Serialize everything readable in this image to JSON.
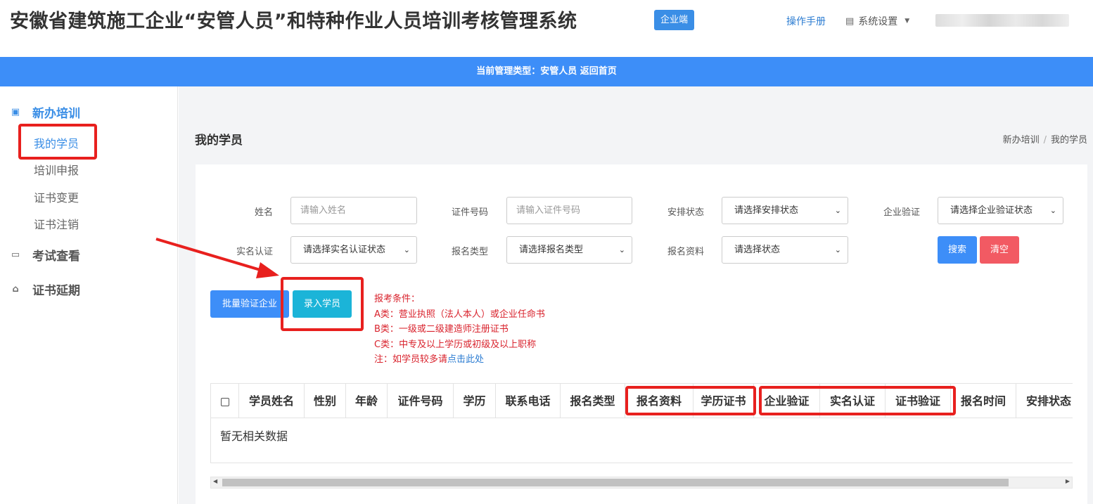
{
  "header": {
    "title": "安徽省建筑施工企业“安管人员”和特种作业人员培训考核管理系统",
    "badge": "企业端",
    "manual": "操作手册",
    "settings": "系统设置"
  },
  "banner": {
    "text": "当前管理类型：安管人员 返回首页"
  },
  "sidebar": {
    "group_new_training": "新办培训",
    "items": [
      "我的学员",
      "培训申报",
      "证书变更",
      "证书注销"
    ],
    "group_exam": "考试查看",
    "group_extend": "证书延期"
  },
  "page": {
    "title": "我的学员",
    "breadcrumb": [
      "新办培训",
      "我的学员"
    ]
  },
  "filters": {
    "name_label": "姓名",
    "name_placeholder": "请输入姓名",
    "id_label": "证件号码",
    "id_placeholder": "请输入证件号码",
    "arrange_label": "安排状态",
    "arrange_value": "请选择安排状态",
    "company_label": "企业验证",
    "company_value": "请选择企业验证状态",
    "realname_label": "实名认证",
    "realname_value": "请选择实名认证状态",
    "type_label": "报名类型",
    "type_value": "请选择报名类型",
    "material_label": "报名资料",
    "material_value": "请选择状态",
    "search": "搜索",
    "clear": "清空"
  },
  "actions": {
    "batch_verify": "批量验证企业",
    "add_student": "录入学员"
  },
  "notes": {
    "title": "报考条件：",
    "a": "A类：营业执照（法人本人）或企业任命书",
    "b": "B类：一级或二级建造师注册证书",
    "c": "C类：中专及以上学历或初级及以上职称",
    "d_prefix": "注：如学员较多请",
    "d_link": "点击此处"
  },
  "table": {
    "columns": [
      "学员姓名",
      "性别",
      "年龄",
      "证件号码",
      "学历",
      "联系电话",
      "报名类型",
      "报名资料",
      "学历证书",
      "企业验证",
      "实名认证",
      "证书验证",
      "报名时间",
      "安排状态"
    ],
    "empty": "暂无相关数据"
  },
  "colors": {
    "primary": "#3d8ef8",
    "info": "#1bb4d8",
    "danger": "#f25a63",
    "annotation": "#e8201e"
  }
}
